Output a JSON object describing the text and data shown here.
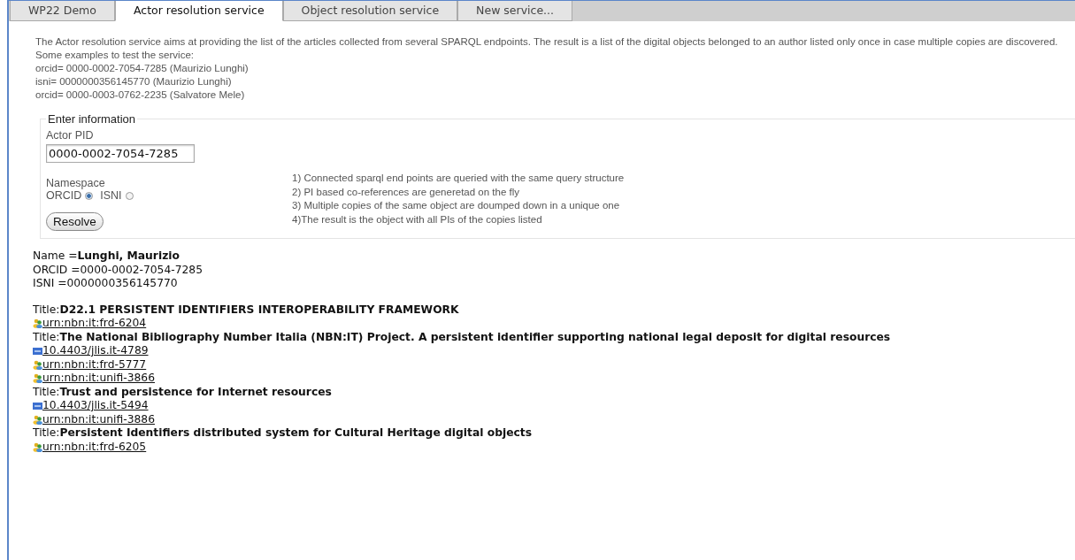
{
  "tabs": [
    {
      "label": "WP22 Demo",
      "selected": false
    },
    {
      "label": "Actor resolution service",
      "selected": true
    },
    {
      "label": "Object resolution service",
      "selected": false
    },
    {
      "label": "New service...",
      "selected": false
    }
  ],
  "description": [
    "The Actor resolution service aims at providing the list of the articles collected from several SPARQL endpoints. The result is a list of the digital objects belonged to an author listed only once in case multiple copies are discovered.",
    "Some examples to test the service:",
    "orcid= 0000-0002-7054-7285 (Maurizio Lunghi)",
    "isni= 0000000356145770 (Maurizio Lunghi)",
    "orcid= 0000-0003-0762-2235 (Salvatore Mele)"
  ],
  "form": {
    "legend": "Enter information",
    "pid_label": "Actor PID",
    "pid_value": "0000-0002-7054-7285",
    "namespace_label": "Namespace",
    "namespaces": [
      {
        "label": "ORCID",
        "selected": true
      },
      {
        "label": "ISNI",
        "selected": false
      }
    ],
    "button": "Resolve"
  },
  "notes": [
    "1) Connected sparql end points are queried with the same query structure",
    "2) PI based co-references are generetad on the fly",
    "3) Multiple copies of the same object are doumped down in a unique one",
    "4)The result is the object with all PIs of the copies listed"
  ],
  "actor": [
    "Name =**Lunghi, Maurizio**",
    "ORCID =0000-0002-7054-7285",
    "ISNI =0000000356145770"
  ],
  "results": [
    {
      "title": "Title:**D22.1 PERSISTENT IDENTIFIERS INTEROPERABILITY FRAMEWORK**",
      "identifiers": [
        {
          "kind": "urn",
          "label": "urn:nbn:it:frd-6204"
        }
      ]
    },
    {
      "title": "Title:**The National Bibliography Number Italia (NBN:IT) Project. A persistent identifier supporting national legal deposit for digital resources**",
      "identifiers": [
        {
          "kind": "doi",
          "label": "10.4403/jlis.it-4789"
        },
        {
          "kind": "urn",
          "label": "urn:nbn:it:frd-5777"
        },
        {
          "kind": "urn",
          "label": "urn:nbn:it:unifi-3866"
        }
      ]
    },
    {
      "title": "Title:**Trust and persistence for Internet resources**",
      "identifiers": [
        {
          "kind": "doi",
          "label": "10.4403/jlis.it-5494"
        },
        {
          "kind": "urn",
          "label": "urn:nbn:it:unifi-3886"
        }
      ]
    },
    {
      "title": "Title:**Persistent Identifiers distributed system for Cultural Heritage digital objects**",
      "identifiers": [
        {
          "kind": "urn",
          "label": "urn:nbn:it:frd-6205"
        }
      ]
    }
  ]
}
